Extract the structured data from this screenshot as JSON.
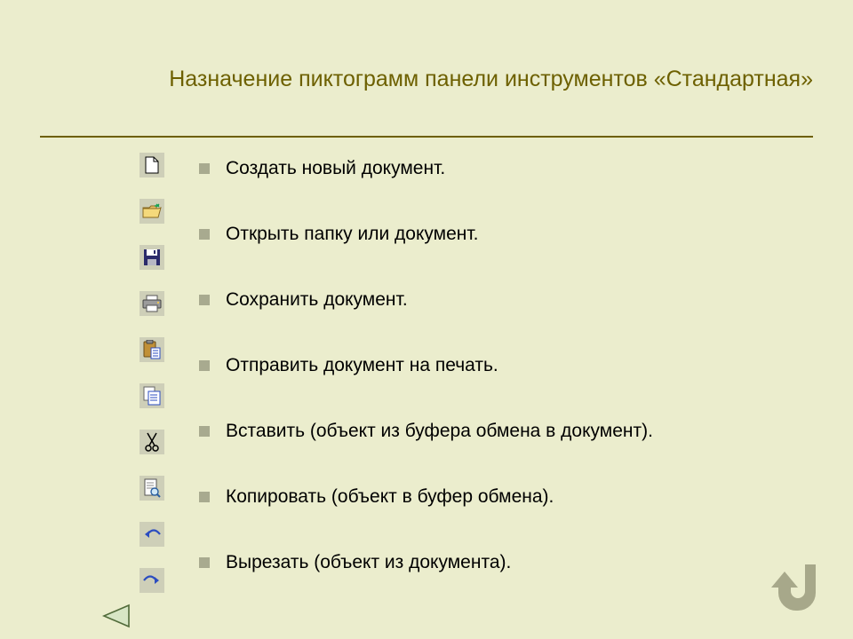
{
  "title": "Назначение пиктограмм панели инструментов «Стандартная»",
  "icons": [
    {
      "name": "new-document-icon"
    },
    {
      "name": "open-folder-icon"
    },
    {
      "name": "save-icon"
    },
    {
      "name": "print-icon"
    },
    {
      "name": "paste-icon"
    },
    {
      "name": "copy-icon"
    },
    {
      "name": "cut-icon"
    },
    {
      "name": "print-preview-icon"
    },
    {
      "name": "undo-icon"
    },
    {
      "name": "redo-icon"
    }
  ],
  "items": [
    "Создать новый документ.",
    "Открыть папку или документ.",
    "Сохранить документ.",
    "Отправить документ на печать.",
    "Вставить (объект из буфера обмена в документ).",
    "Копировать (объект в буфер обмена).",
    "Вырезать (объект из документа)."
  ]
}
